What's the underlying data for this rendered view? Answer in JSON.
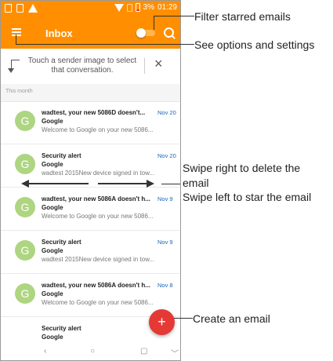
{
  "status_bar": {
    "battery_text": "3%",
    "time": "01:29"
  },
  "app_bar": {
    "title": "Inbox"
  },
  "tip": {
    "text": "Touch a sender image to select that conversation.",
    "close": "×"
  },
  "section": {
    "label": "This month"
  },
  "emails": [
    {
      "avatar": "G",
      "subject": "wadtest, your new 5086D doesn't...",
      "date": "Nov 20",
      "sender": "Google",
      "preview": "Welcome to Google on your new 5086..."
    },
    {
      "avatar": "G",
      "subject": "Security alert",
      "date": "Nov 20",
      "sender": "Google",
      "preview": "wadtest 2015New device signed in tow..."
    },
    {
      "avatar": "G",
      "subject": "wadtest, your new 5086A doesn't h...",
      "date": "Nov 9",
      "sender": "Google",
      "preview": "Welcome to Google on your new 5086..."
    },
    {
      "avatar": "G",
      "subject": "Security alert",
      "date": "Nov 9",
      "sender": "Google",
      "preview": "wadtest 2015New device signed in tow..."
    },
    {
      "avatar": "G",
      "subject": "wadtest, your new 5086A doesn't h...",
      "date": "Nov 8",
      "sender": "Google",
      "preview": "Welcome to Google on your new 5086..."
    },
    {
      "avatar": "",
      "subject": "Security alert",
      "date": "",
      "sender": "Google",
      "preview": ""
    }
  ],
  "fab": {
    "label": "+"
  },
  "navbar": {
    "back": "‹",
    "home": "○",
    "recent": "▢",
    "down": "﹀"
  },
  "callouts": {
    "filter": "Filter starred emails",
    "options": "See options and settings",
    "swipe_right": "Swipe right to delete the",
    "swipe_right_2": "email",
    "swipe_left": "Swipe left to star the email",
    "create": "Create an email"
  }
}
